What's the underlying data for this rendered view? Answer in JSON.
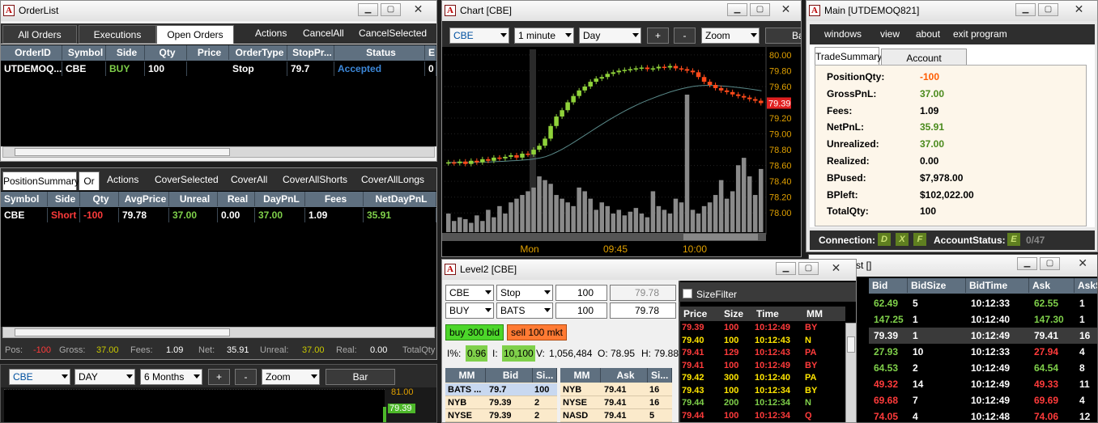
{
  "orderlist": {
    "title": "OrderList",
    "tabs": [
      "All Orders",
      "Executions",
      "Open Orders"
    ],
    "actions": [
      "Actions",
      "CancelAll",
      "CancelSelected"
    ],
    "headers": [
      "OrderID",
      "Symbol",
      "Side",
      "Qty",
      "Price",
      "OrderType",
      "StopPr...",
      "Status",
      "E"
    ],
    "row": [
      "UTDEMOQ...",
      "CBE",
      "BUY",
      "100",
      "",
      "Stop",
      "79.7",
      "Accepted",
      "0"
    ]
  },
  "positions": {
    "tab": "PositionSummary",
    "tab2": "Or",
    "actions": [
      "Actions",
      "CoverSelected",
      "CoverAll",
      "CoverAllShorts",
      "CoverAllLongs"
    ],
    "headers": [
      "Symbol",
      "Side",
      "Qty",
      "AvgPrice",
      "Unreal",
      "Real",
      "DayPnL",
      "Fees",
      "NetDayPnL"
    ],
    "row": [
      "CBE",
      "Short",
      "-100",
      "79.78",
      "37.00",
      "0.00",
      "37.00",
      "1.09",
      "35.91"
    ],
    "status": {
      "pos_l": "Pos:",
      "pos": "-100",
      "gross_l": "Gross:",
      "gross": "37.00",
      "fees_l": "Fees:",
      "fees": "1.09",
      "net_l": "Net:",
      "net": "35.91",
      "unreal_l": "Unreal:",
      "unreal": "37.00",
      "real_l": "Real:",
      "real": "0.00",
      "totq_l": "TotalQty"
    }
  },
  "minichart": {
    "symbol": "CBE",
    "tif": "DAY",
    "range": "6 Months",
    "plus": "+",
    "minus": "-",
    "zoom": "Zoom",
    "bar": "Bar",
    "price_top": "81.00",
    "price_tag": "79.39"
  },
  "chart": {
    "title": "Chart [CBE]",
    "symbol": "CBE",
    "interval": "1 minute",
    "period": "Day",
    "plus": "+",
    "minus": "-",
    "zoom": "Zoom",
    "bar": "Ba",
    "price_ticks": [
      "80.00",
      "79.80",
      "79.60",
      "79.40",
      "79.20",
      "79.00",
      "78.80",
      "78.60",
      "78.40",
      "78.20",
      "78.00"
    ],
    "price_tag": "79.39",
    "time_ticks": [
      "Mon",
      "09:45",
      "10:00"
    ],
    "chart_data": {
      "type": "candlestick",
      "y_range": [
        77.9,
        80.05
      ],
      "close": [
        78.64,
        78.63,
        78.65,
        78.62,
        78.66,
        78.64,
        78.68,
        78.66,
        78.7,
        78.69,
        78.71,
        78.73,
        78.7,
        78.75,
        78.74,
        78.8,
        78.85,
        78.94,
        79.1,
        79.22,
        79.3,
        79.4,
        79.48,
        79.55,
        79.6,
        79.66,
        79.7,
        79.72,
        79.76,
        79.78,
        79.8,
        79.81,
        79.82,
        79.83,
        79.84,
        79.82,
        79.83,
        79.85,
        79.84,
        79.86,
        79.83,
        79.82,
        79.8,
        79.78,
        79.72,
        79.66,
        79.62,
        79.58,
        79.55,
        79.53,
        79.5,
        79.48,
        79.46,
        79.44,
        79.42,
        79.39
      ],
      "volume": [
        10,
        6,
        8,
        7,
        5,
        9,
        6,
        12,
        8,
        14,
        10,
        16,
        18,
        20,
        22,
        24,
        30,
        28,
        26,
        20,
        18,
        16,
        14,
        24,
        22,
        18,
        12,
        16,
        14,
        10,
        12,
        9,
        11,
        13,
        10,
        8,
        22,
        14,
        12,
        10,
        18,
        16,
        74,
        12,
        10,
        14,
        16,
        20,
        28,
        18,
        22,
        36,
        40,
        30,
        20,
        34
      ]
    }
  },
  "main": {
    "title": "Main [UTDEMOQ821]",
    "menu": [
      "windows",
      "view",
      "about",
      "exit program"
    ],
    "tabs": [
      "TradeSummary",
      "Account Parameters"
    ],
    "fields": [
      {
        "l": "PositionQty:",
        "v": "-100",
        "c": "#ff5c00"
      },
      {
        "l": "GrossPnL:",
        "v": "37.00",
        "c": "#4a8a1c"
      },
      {
        "l": "Fees:",
        "v": "1.09",
        "c": "#000"
      },
      {
        "l": "NetPnL:",
        "v": "35.91",
        "c": "#4a8a1c"
      },
      {
        "l": "Unrealized:",
        "v": "37.00",
        "c": "#4a8a1c"
      },
      {
        "l": "Realized:",
        "v": "0.00",
        "c": "#000"
      },
      {
        "l": "BPused:",
        "v": "$7,978.00",
        "c": "#000"
      },
      {
        "l": "BPleft:",
        "v": "$102,022.00",
        "c": "#000"
      },
      {
        "l": "TotalQty:",
        "v": "100",
        "c": "#000"
      }
    ],
    "conn_label": "Connection:",
    "conn": [
      "D",
      "X",
      "F"
    ],
    "acct_label": "AccountStatus:",
    "acct": "E",
    "acct_count": "0/47"
  },
  "level2": {
    "title": "Level2 [CBE]",
    "symbol": "CBE",
    "order_type": "Stop",
    "qty1": "100",
    "price1": "79.78",
    "side": "BUY",
    "route": "BATS",
    "qty2": "100",
    "price2": "79.78",
    "buy_btn": "buy 300 bid",
    "sell_btn": "sell 100 mkt",
    "stats": {
      "i_pct_l": "I%:",
      "i_pct": "0.96",
      "i_l": "I:",
      "i": "10,100",
      "v_l": "V:",
      "v": "1,056,484",
      "o_l": "O:",
      "o": "78.95",
      "h_l": "H:",
      "h": "79.88"
    },
    "bid_headers": [
      "MM",
      "Bid",
      "Si..."
    ],
    "ask_headers": [
      "MM",
      "Ask",
      "Si..."
    ],
    "bids": [
      [
        "BATS ...",
        "79.7",
        "100"
      ],
      [
        "NYB",
        "79.39",
        "2"
      ],
      [
        "NYSE",
        "79.39",
        "2"
      ]
    ],
    "asks": [
      [
        "NYB",
        "79.41",
        "16"
      ],
      [
        "NYSE",
        "79.41",
        "16"
      ],
      [
        "NASD",
        "79.41",
        "5"
      ]
    ],
    "sizefilter": "SizeFilter",
    "tape_headers": [
      "Price",
      "Size",
      "Time",
      "MM"
    ],
    "tape": [
      [
        "79.39",
        "100",
        "10:12:49",
        "BY",
        "r"
      ],
      [
        "79.40",
        "100",
        "10:12:43",
        "N",
        "y"
      ],
      [
        "79.41",
        "129",
        "10:12:43",
        "PA",
        "r"
      ],
      [
        "79.41",
        "100",
        "10:12:49",
        "BY",
        "r"
      ],
      [
        "79.42",
        "300",
        "10:12:40",
        "PA",
        "y"
      ],
      [
        "79.43",
        "100",
        "10:12:34",
        "BY",
        "y"
      ],
      [
        "79.44",
        "200",
        "10:12:34",
        "N",
        "g"
      ],
      [
        "79.44",
        "100",
        "10:12:34",
        "Q",
        "r"
      ]
    ]
  },
  "watchlist": {
    "title": "st []",
    "headers": [
      "Bid",
      "BidSize",
      "BidTime",
      "Ask",
      "AskS"
    ],
    "rows": [
      [
        "62.49",
        "5",
        "10:12:33",
        "62.55",
        "1",
        "g",
        "g"
      ],
      [
        "147.25",
        "1",
        "10:12:40",
        "147.30",
        "1",
        "g",
        "g"
      ],
      [
        "79.39",
        "1",
        "10:12:49",
        "79.41",
        "16",
        "w",
        "w"
      ],
      [
        "27.93",
        "10",
        "10:12:33",
        "27.94",
        "4",
        "g",
        "r"
      ],
      [
        "64.53",
        "2",
        "10:12:49",
        "64.54",
        "8",
        "g",
        "g"
      ],
      [
        "49.32",
        "14",
        "10:12:49",
        "49.33",
        "11",
        "r",
        "r"
      ],
      [
        "69.68",
        "7",
        "10:12:49",
        "69.69",
        "4",
        "r",
        "r"
      ],
      [
        "74.05",
        "4",
        "10:12:48",
        "74.06",
        "12",
        "r",
        "r"
      ]
    ]
  }
}
